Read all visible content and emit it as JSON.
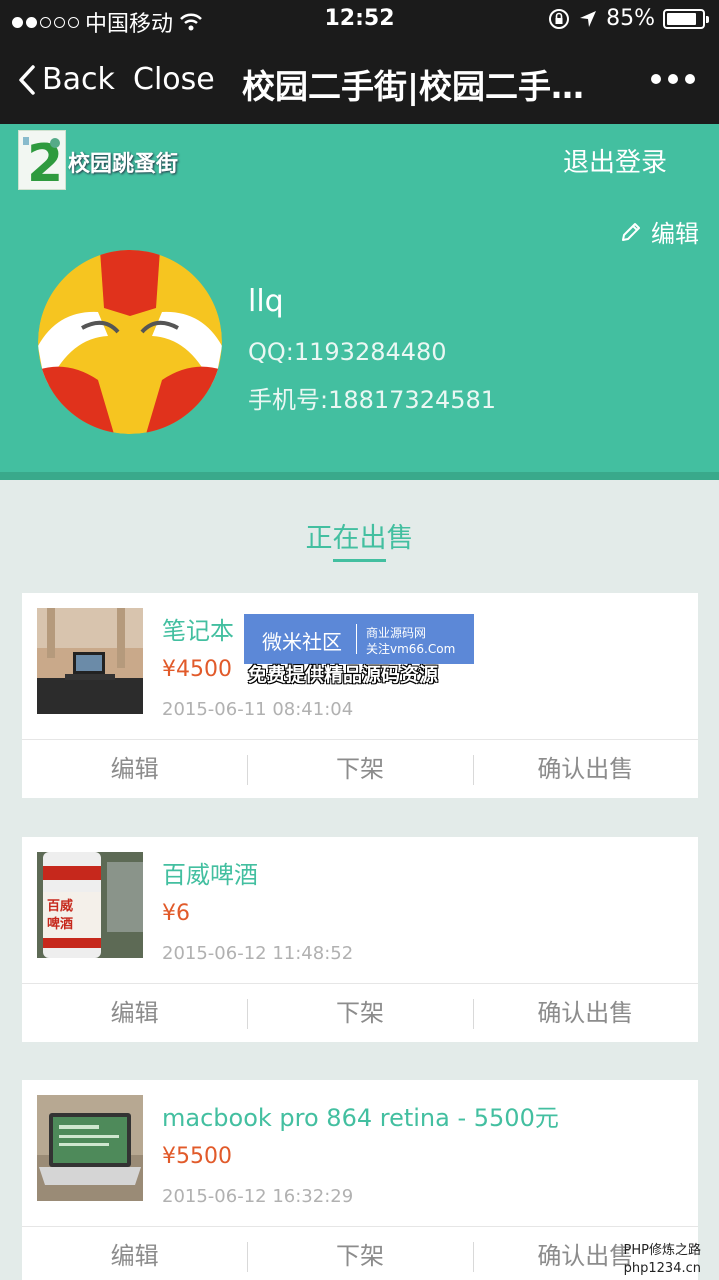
{
  "status_bar": {
    "carrier": "中国移动",
    "time": "12:52",
    "battery": "85%",
    "battery_level": 0.85
  },
  "nav": {
    "back_label": "Back",
    "close_label": "Close",
    "title": "校园二手街|校园二手…"
  },
  "app": {
    "logo_text": "校园跳蚤街",
    "logout_label": "退出登录"
  },
  "profile": {
    "edit_label": "编辑",
    "username": "llq",
    "qq": "QQ:1193284480",
    "phone": "手机号:18817324581"
  },
  "section": {
    "title": "正在出售"
  },
  "items": [
    {
      "title": "笔记本",
      "price": "¥4500",
      "date": "2015-06-11 08:41:04",
      "actions": [
        "编辑",
        "下架",
        "确认出售"
      ]
    },
    {
      "title": "百威啤酒",
      "price": "¥6",
      "date": "2015-06-12 11:48:52",
      "actions": [
        "编辑",
        "下架",
        "确认出售"
      ]
    },
    {
      "title": "macbook pro 864 retina - 5500元",
      "price": "¥5500",
      "date": "2015-06-12 16:32:29",
      "actions": [
        "编辑",
        "下架",
        "确认出售"
      ]
    }
  ],
  "watermark": {
    "main": "微米社区",
    "sub1": "商业源码网",
    "sub2": "关注vm66.Com",
    "tagline": "免费提供精品源码资源",
    "corner1": "PHP修炼之路",
    "corner2": "php1234.cn"
  },
  "colors": {
    "brand": "#43bfa0",
    "price": "#e15a2a",
    "navbar": "#1b1b1b"
  }
}
